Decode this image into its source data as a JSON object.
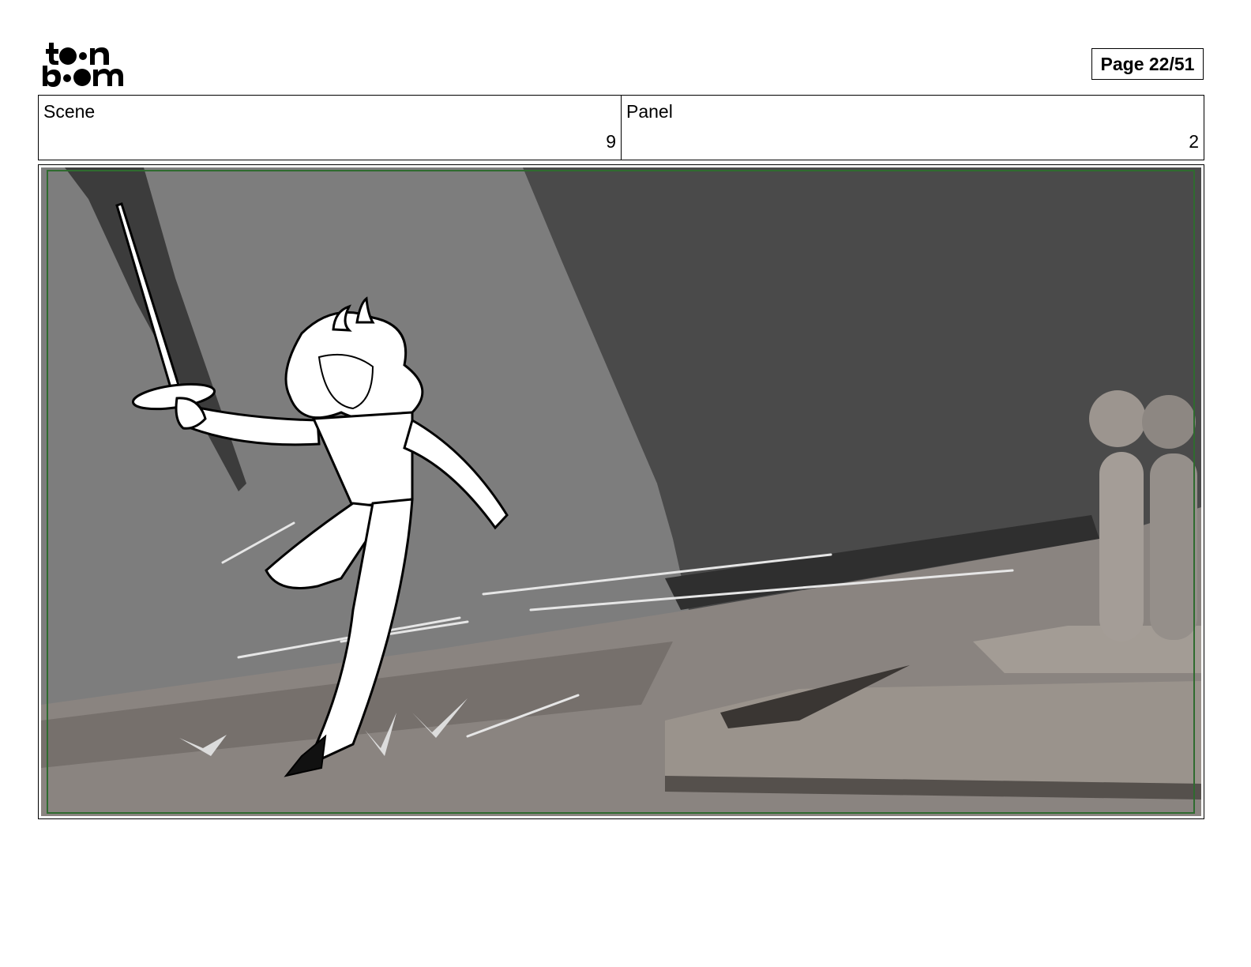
{
  "header": {
    "logo": {
      "name": "toon-boom-logo",
      "line1": "toon",
      "line2": "boom"
    },
    "page_label": "Page 22/51"
  },
  "info": {
    "scene_label": "Scene",
    "scene_value": "9",
    "panel_label": "Panel",
    "panel_value": "2"
  },
  "panel": {
    "image": "storyboard-sketch: character in white with horns lunging forward holding a rapier, grey stage wall and floor, two mannequin-like figures on the right",
    "safe_area_color": "#2f6b2f"
  },
  "colors": {
    "wall_dark": "#4a4a4a",
    "wall_light": "#7d7d7d",
    "floor": "#8a8480",
    "figure_fill": "#ffffff",
    "ink": "#000000"
  }
}
